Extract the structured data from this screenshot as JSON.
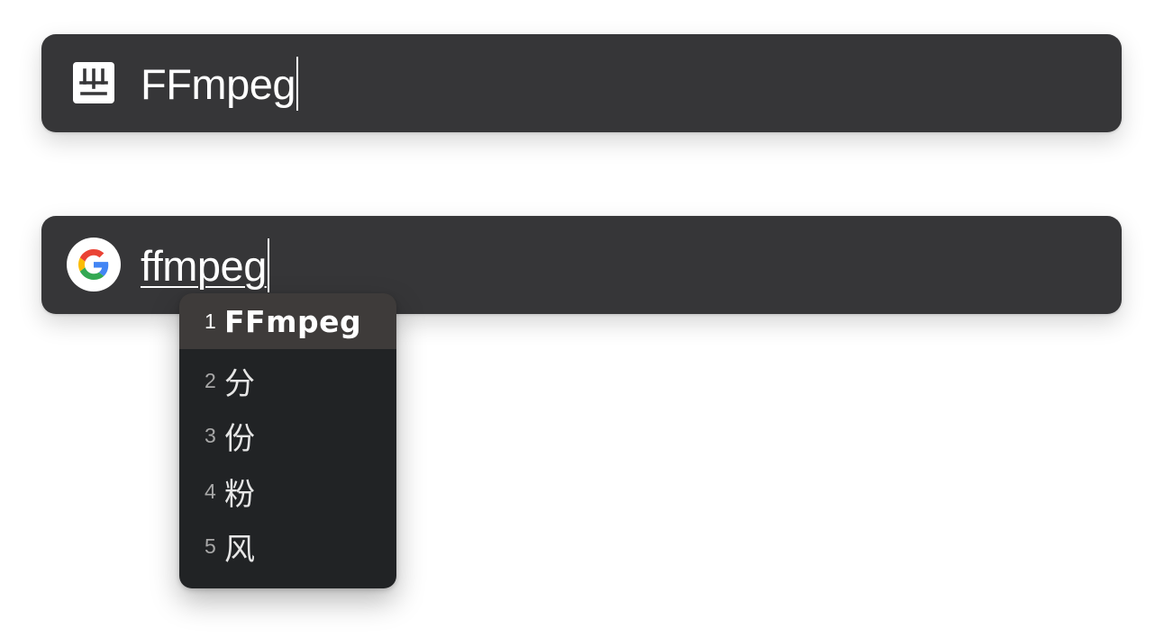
{
  "top_bar": {
    "icon": "app-logo-icon",
    "query": "FFmpeg"
  },
  "bottom_bar": {
    "icon": "google-icon",
    "query": "ffmpeg"
  },
  "ime_candidates": {
    "items": [
      {
        "number": "1",
        "text": "FFmpeg",
        "selected": true
      },
      {
        "number": "2",
        "text": "分",
        "selected": false
      },
      {
        "number": "3",
        "text": "份",
        "selected": false
      },
      {
        "number": "4",
        "text": "粉",
        "selected": false
      },
      {
        "number": "5",
        "text": "风",
        "selected": false
      }
    ]
  },
  "colors": {
    "bar_background": "#363638",
    "popup_background": "#212325",
    "popup_selected": "#3e3b3a",
    "text": "#ffffff"
  }
}
